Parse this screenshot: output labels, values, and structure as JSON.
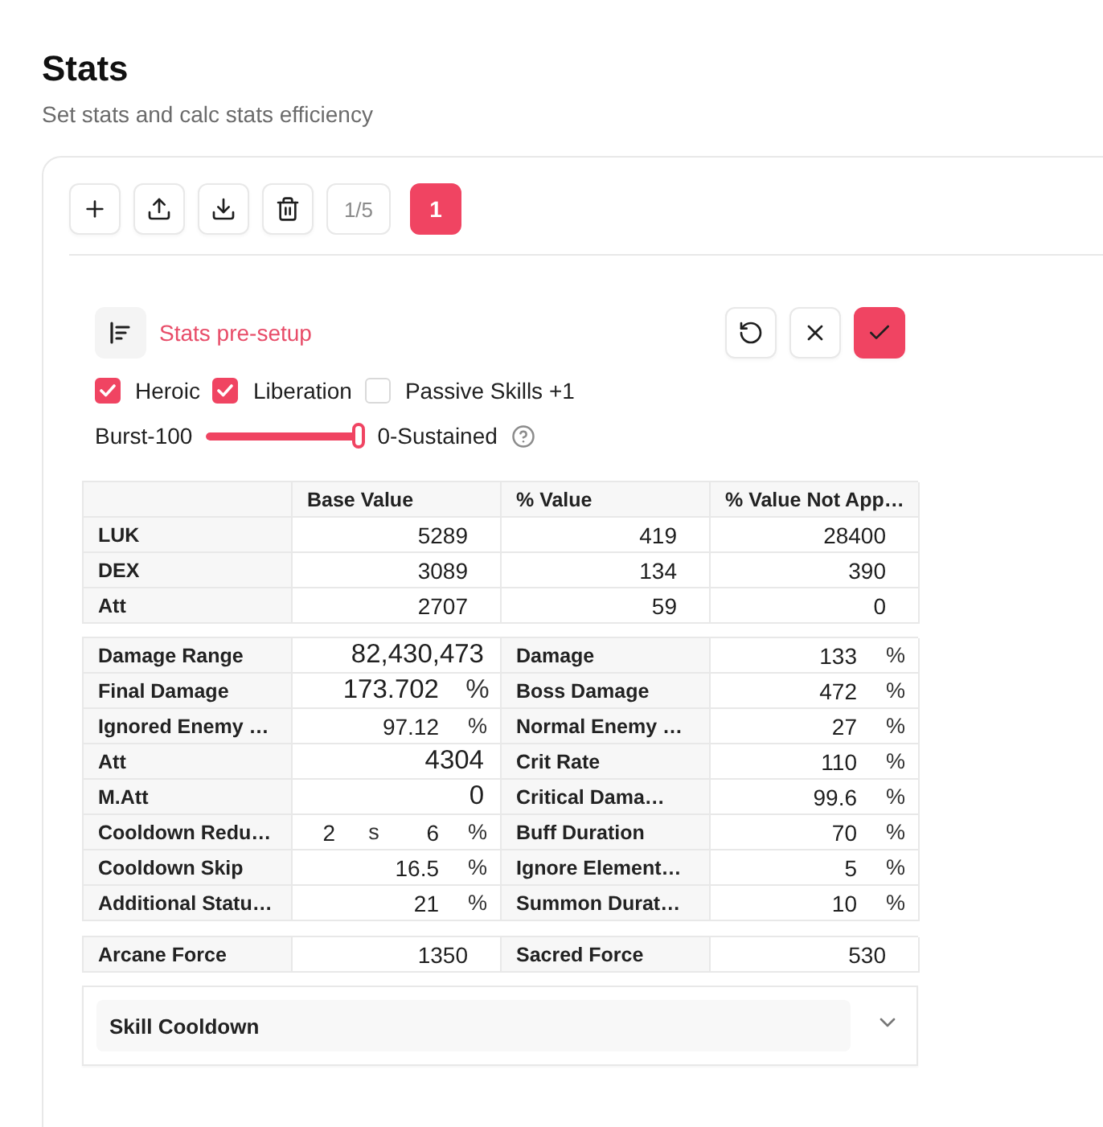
{
  "header": {
    "title": "Stats",
    "subtitle": "Set stats and calc stats efficiency"
  },
  "toolbar": {
    "page_indicator": "1/5",
    "presets": [
      {
        "label": "1",
        "selected": true
      }
    ]
  },
  "pre_setup": {
    "title": "Stats pre-setup",
    "options": [
      {
        "label": "Heroic",
        "checked": true
      },
      {
        "label": "Liberation",
        "checked": true
      },
      {
        "label": "Passive Skills +1",
        "checked": false
      }
    ],
    "slider": {
      "start_label": "Burst-100",
      "end_label": "0-Sustained",
      "level": 1
    }
  },
  "base_stats": {
    "columns": [
      "Base Value",
      "% Value",
      "% Value Not App…"
    ],
    "rows": [
      {
        "label": "LUK",
        "values": [
          "5289",
          "419",
          "28400"
        ]
      },
      {
        "label": "DEX",
        "values": [
          "3089",
          "134",
          "390"
        ]
      },
      {
        "label": "Att",
        "values": [
          "2707",
          "59",
          "0"
        ]
      }
    ]
  },
  "stats": [
    {
      "label": "Damage Range",
      "kind": "computed",
      "parts": [
        {
          "value": "82,430,473"
        }
      ]
    },
    {
      "label": "Damage",
      "kind": "input",
      "parts": [
        {
          "value": "133",
          "unit": "%"
        }
      ]
    },
    {
      "label": "Final Damage",
      "kind": "computed",
      "parts": [
        {
          "value": "173.702",
          "unit": "%"
        }
      ]
    },
    {
      "label": "Boss Damage",
      "kind": "input",
      "parts": [
        {
          "value": "472",
          "unit": "%"
        }
      ]
    },
    {
      "label": "Ignored Enemy …",
      "kind": "input",
      "parts": [
        {
          "value": "97.12",
          "unit": "%"
        }
      ]
    },
    {
      "label": "Normal Enemy …",
      "kind": "input",
      "parts": [
        {
          "value": "27",
          "unit": "%"
        }
      ]
    },
    {
      "label": "Att",
      "kind": "computed",
      "parts": [
        {
          "value": "4304"
        }
      ]
    },
    {
      "label": "Crit Rate",
      "kind": "input",
      "parts": [
        {
          "value": "110",
          "unit": "%"
        }
      ]
    },
    {
      "label": "M.Att",
      "kind": "computed",
      "parts": [
        {
          "value": "0"
        }
      ]
    },
    {
      "label": "Critical Dama…",
      "kind": "input",
      "parts": [
        {
          "value": "99.6",
          "unit": "%"
        }
      ]
    },
    {
      "label": "Cooldown Redu…",
      "kind": "input",
      "parts": [
        {
          "value": "2",
          "unit": "s"
        },
        {
          "value": "6",
          "unit": "%"
        }
      ]
    },
    {
      "label": "Buff Duration",
      "kind": "input",
      "parts": [
        {
          "value": "70",
          "unit": "%"
        }
      ]
    },
    {
      "label": "Cooldown Skip",
      "kind": "input",
      "parts": [
        {
          "value": "16.5",
          "unit": "%"
        }
      ]
    },
    {
      "label": "Ignore Element…",
      "kind": "input",
      "parts": [
        {
          "value": "5",
          "unit": "%"
        }
      ]
    },
    {
      "label": "Additional Statu…",
      "kind": "input",
      "parts": [
        {
          "value": "21",
          "unit": "%"
        }
      ]
    },
    {
      "label": "Summon Durat…",
      "kind": "input",
      "parts": [
        {
          "value": "10",
          "unit": "%"
        }
      ]
    }
  ],
  "forces": [
    {
      "label": "Arcane Force",
      "value": "1350"
    },
    {
      "label": "Sacred Force",
      "value": "530"
    }
  ],
  "skill_cooldown": {
    "title": "Skill Cooldown",
    "expanded": false
  }
}
